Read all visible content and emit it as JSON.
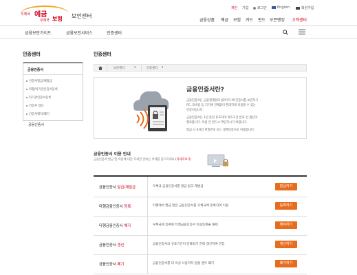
{
  "header": {
    "logo": {
      "top_left": "우체국",
      "top_big": "예금",
      "bottom_left": "우체국",
      "bottom_big": "보험"
    },
    "site_title": "보안센터",
    "utility": [
      {
        "label": "개인",
        "active": true
      },
      {
        "label": "기업",
        "active": false
      },
      {
        "label": "로그인",
        "active": false
      },
      {
        "label": "English",
        "active": false,
        "flag": "uk-flag"
      },
      {
        "label": "회원가입",
        "active": false,
        "flag": "globe"
      }
    ],
    "main_nav": [
      {
        "label": "금융상품",
        "active": false
      },
      {
        "label": "예금",
        "active": false
      },
      {
        "label": "보험",
        "active": false
      },
      {
        "label": "카드",
        "active": false
      },
      {
        "label": "펀드",
        "active": false
      },
      {
        "label": "오픈뱅킹",
        "active": false
      },
      {
        "label": "고객센터",
        "active": true
      }
    ]
  },
  "subnav": {
    "items": [
      "금융보안가이드",
      "금융보안서비스",
      "인증센터"
    ],
    "search_icon": "search-icon",
    "menu_icon": "hamburger-icon"
  },
  "sidebar": {
    "title": "인증센터",
    "active_item": "금융인증서",
    "sub_items": [
      "인증서발급/재발급",
      "타행/타기관인증서등록",
      "타기관인증서등록",
      "인증서 갱신",
      "인증서해지/폐기"
    ],
    "other_item": "공동인증서"
  },
  "content": {
    "title": "인증센터",
    "breadcrumb": [
      "보안센터",
      "인증센터"
    ],
    "hero": {
      "heading": "금융인증서란?",
      "paragraphs": [
        "금융인증서는 금융결제원의 클라우드에 인증서를 보관하고",
        "PC, 모바일 등 기기에 관계없이 편리하게 이용할 수 있는",
        "인증서입니다.",
        "금융인증서는 1년 동안 유효하며 유효기간 만료 전 갱신이",
        "필요합니다. 이용 전 반드시 확인하시기 바랍니다.",
        "발급 시 6자리 비밀번호 또는 생체인증으로 이용합니다."
      ]
    },
    "guide": {
      "title": "금융인증서 이용 안내",
      "desc_before": "금융인증서 발급 및 이용에 대한 자세한 안내는 아래를 참고하세요.",
      "desc_highlight": "(자세히보기)"
    },
    "rows": [
      {
        "name_prefix": "금융인증서",
        "name_suffix": "발급/재발급",
        "desc": "우체국 금융인증서를 발급 받고 재발급",
        "button": "발급하기"
      },
      {
        "name_prefix": "타행금융인증서",
        "name_suffix": "등록",
        "desc": "타행에서 발급 받은 금융인증서를 우체국에 등록하여 이용",
        "button": "등록하기"
      },
      {
        "name_prefix": "타행금융인증서",
        "name_suffix": "해지",
        "desc": "우체국에 등록된 타행금융인증서 이용등록을 해제",
        "button": "해지하기"
      },
      {
        "name_prefix": "금융인증서",
        "name_suffix": "갱신",
        "desc": "금융인증서의 유효기간이 만료되기 전에 갱신하여 연장",
        "button": "갱신하기"
      },
      {
        "name_prefix": "금융인증서",
        "name_suffix": "폐기",
        "desc": "금융인증서를 더 이상 사용하지 않을 경우 폐기",
        "button": "폐기하기"
      }
    ]
  },
  "colors": {
    "accent": "#e86c1d",
    "brand_red": "#d4001c"
  }
}
